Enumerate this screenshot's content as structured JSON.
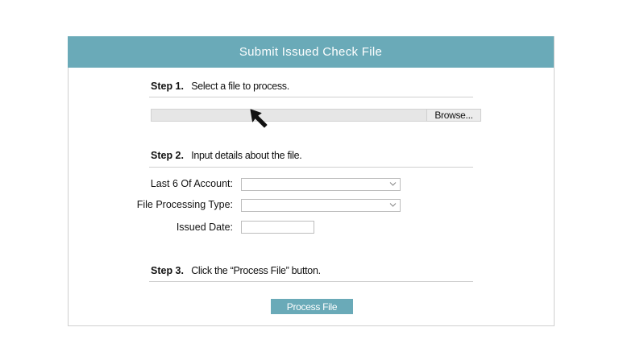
{
  "header": {
    "title": "Submit Issued Check File"
  },
  "steps": [
    {
      "number": "Step 1.",
      "text": "Select a file to process."
    },
    {
      "number": "Step 2.",
      "text": "Input details about the file."
    },
    {
      "number": "Step 3.",
      "text": "Click the “Process File” button."
    }
  ],
  "file_picker": {
    "value": "",
    "browse_label": "Browse..."
  },
  "fields": {
    "account": {
      "label": "Last 6 Of Account:",
      "value": ""
    },
    "processing_type": {
      "label": "File Processing Type:",
      "value": ""
    },
    "issued_date": {
      "label": "Issued Date:",
      "value": ""
    }
  },
  "actions": {
    "process_label": "Process File"
  },
  "icons": {
    "cursor": "mouse-pointer-icon",
    "dropdown": "chevron-down-icon"
  },
  "colors": {
    "accent": "#6aaab8",
    "border": "#cfcfcf"
  }
}
